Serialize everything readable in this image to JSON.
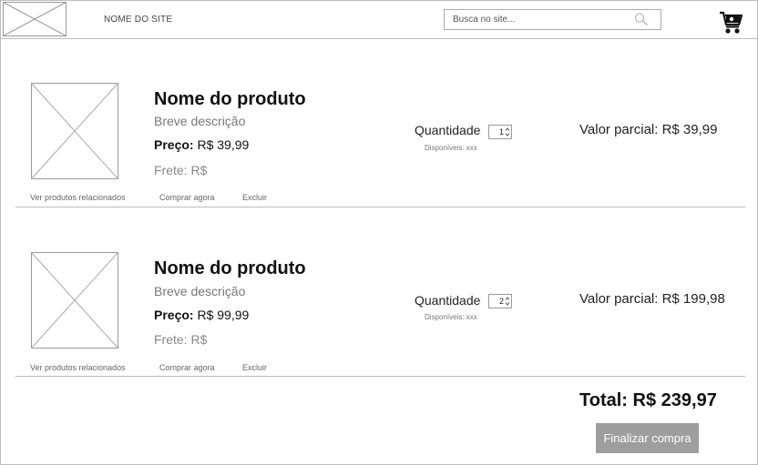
{
  "header": {
    "site_name": "NOME DO SITE",
    "search_placeholder": "Busca no site...",
    "search_icon": "search-icon",
    "cart_icon": "cart-icon"
  },
  "products": [
    {
      "name": "Nome do produto",
      "description": "Breve descrição",
      "price_label": "Preço:",
      "price_value": "R$ 39,99",
      "freight": "Frete: R$",
      "quantity_label": "Quantidade",
      "quantity": "1",
      "available": "Disponíveis: xxx",
      "subtotal": "Valor parcial: R$ 39,99",
      "links": {
        "related": "Ver produtos relacionados",
        "buy_now": "Comprar agora",
        "delete": "Excluir"
      }
    },
    {
      "name": "Nome do produto",
      "description": "Breve descrição",
      "price_label": "Preço:",
      "price_value": "R$ 99,99",
      "freight": "Frete: R$",
      "quantity_label": "Quantidade",
      "quantity": "2",
      "available": "Disponíveis: xxx",
      "subtotal": "Valor parcial: R$ 199,98",
      "links": {
        "related": "Ver produtos relacionados",
        "buy_now": "Comprar agora",
        "delete": "Excluir"
      }
    }
  ],
  "summary": {
    "total_label": "Total:",
    "total_value": "R$ 239,97",
    "checkout_label": "Finalizar compra"
  },
  "colors": {
    "border": "#bdbdbd",
    "button_bg": "#9e9e9e",
    "button_text": "#ffffff"
  }
}
